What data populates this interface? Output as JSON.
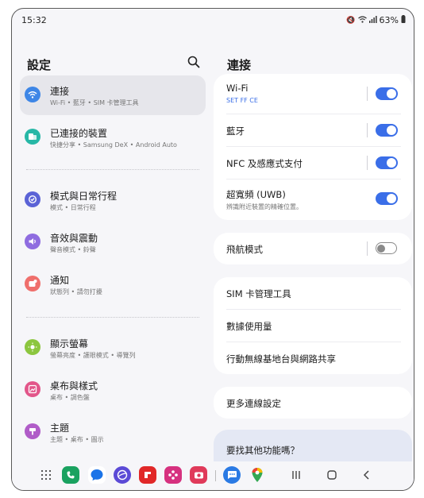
{
  "status": {
    "time": "15:32",
    "battery": "63%"
  },
  "left": {
    "title": "設定",
    "items": [
      {
        "title": "連接",
        "sub": "Wi-Fi • 藍牙 • SIM 卡管理工具"
      },
      {
        "title": "已連接的裝置",
        "sub": "快捷分享 • Samsung DeX • Android Auto"
      },
      {
        "title": "模式與日常行程",
        "sub": "模式 • 日常行程"
      },
      {
        "title": "音效與震動",
        "sub": "聲音模式 • 鈴聲"
      },
      {
        "title": "通知",
        "sub": "狀態列 • 請勿打擾"
      },
      {
        "title": "顯示螢幕",
        "sub": "螢幕亮度 • 護眼模式 • 導覽列"
      },
      {
        "title": "桌布與樣式",
        "sub": "桌布 • 調色盤"
      },
      {
        "title": "主題",
        "sub": "主題 • 桌布 • 圖示"
      }
    ]
  },
  "right": {
    "title": "連接",
    "wifi": {
      "label": "Wi-Fi",
      "sub": "SET FF CE",
      "on": true
    },
    "bluetooth": {
      "label": "藍牙",
      "on": true
    },
    "nfc": {
      "label": "NFC 及感應式支付",
      "on": true
    },
    "uwb": {
      "label": "超寬頻 (UWB)",
      "sub": "辨識附近裝置的精確位置。",
      "on": true
    },
    "airplane": {
      "label": "飛航模式",
      "on": false
    },
    "sim": {
      "label": "SIM 卡管理工具"
    },
    "data_usage": {
      "label": "數據使用量"
    },
    "hotspot": {
      "label": "行動無線基地台與網路共享"
    },
    "more": {
      "label": "更多連線設定"
    },
    "hint": {
      "label": "要找其他功能嗎？"
    }
  },
  "colors": {
    "accent": "#3a6ee8",
    "selected_bg": "#e6e6eb",
    "bg": "#f6f6f9"
  },
  "icons": [
    "apps-grid-icon",
    "phone-app-icon",
    "messages-app-icon",
    "internet-app-icon",
    "flipboard-app-icon",
    "bixby-app-icon",
    "camera-app-icon",
    "chat-app-icon",
    "maps-app-icon",
    "recents-icon",
    "home-icon",
    "back-icon"
  ]
}
